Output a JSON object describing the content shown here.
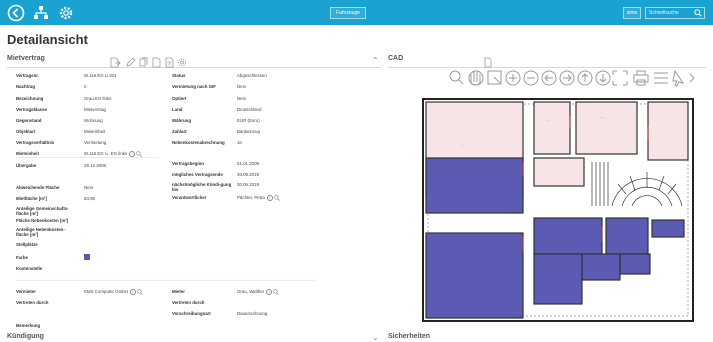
{
  "header": {
    "center_button": "Fahrzeuge",
    "search_button": "sims",
    "search_placeholder": "Schnellsuche"
  },
  "page": {
    "title": "Detailansicht"
  },
  "mietvertrag": {
    "title": "Mietvertrag",
    "left_fields": [
      {
        "label": "Vertragsnr.",
        "value": "W.116.EG Li.001"
      },
      {
        "label": "Nachtrag",
        "value": "0"
      },
      {
        "label": "Bezeichnung",
        "value": "Grau.EG links"
      },
      {
        "label": "Vertragsklasse",
        "value": "Mietvertrag"
      },
      {
        "label": "Gegenstand",
        "value": "Wohnung"
      },
      {
        "label": "Objektart",
        "value": "Mieteinheit"
      },
      {
        "label": "Vertragsverhältnis",
        "value": "Vermietung"
      },
      {
        "label": "Mieteinheit",
        "value": "W.116.EG Li. EG links"
      },
      {
        "label": "Übergabe",
        "value": "29.12.2008"
      }
    ],
    "right_fields": [
      {
        "label": "Status",
        "value": "Abgeschlossen"
      },
      {
        "label": "Vermietung nach GIF",
        "value": "Nein"
      },
      {
        "label": "Optiert",
        "value": "Nein"
      },
      {
        "label": "Land",
        "value": "Deutschland"
      },
      {
        "label": "Währung",
        "value": "EUR (Euro)"
      },
      {
        "label": "Zahlart",
        "value": "Bankeinzug"
      },
      {
        "label": "Nebenkostenabrechnung",
        "value": "Ja"
      }
    ],
    "date_fields": [
      {
        "label": "Vertragsbeginn",
        "value": "01.01.2009"
      },
      {
        "label": "mögliches Vertragsende",
        "value": "30.09.2019"
      },
      {
        "label": "nächstmögliche Kündi-gung bis",
        "value": "30.06.2019"
      },
      {
        "label": "Verantwortlicher",
        "value": "Pächter, Petra"
      }
    ],
    "area_fields": [
      {
        "label": "Abweichende Fläche",
        "value": "Nein"
      },
      {
        "label": "Mietfläche [m²]",
        "value": "83,95"
      },
      {
        "label": "Anteilige Gemeinschafts-fläche [m²]",
        "value": ""
      },
      {
        "label": "Fläche Nebenkosten [m²]",
        "value": ""
      },
      {
        "label": "Anteilige Nebenkosten-fläche [m²]",
        "value": ""
      },
      {
        "label": "Stellplätze",
        "value": ""
      },
      {
        "label": "Farbe",
        "value": ""
      },
      {
        "label": "Kostenstelle",
        "value": ""
      }
    ],
    "party_left": [
      {
        "label": "Vermieter",
        "value": "KMS Computer GmbH"
      },
      {
        "label": "Vertreten durch",
        "value": ""
      }
    ],
    "party_right": [
      {
        "label": "Mieter",
        "value": "Grau, Walther"
      },
      {
        "label": "Vertreten durch",
        "value": ""
      },
      {
        "label": "Vorschreibungsart",
        "value": "Dauerrechnung"
      }
    ],
    "remark_label": "Bemerkung",
    "color_swatch": "#5b5bb3"
  },
  "cad": {
    "title": "CAD"
  },
  "bottom": {
    "left": "Kündigung",
    "right": "Sicherheiten"
  },
  "colors": {
    "topbar": "#1aa3d0",
    "room_pink": "#f6e4e6",
    "room_blue": "#5b5bb3"
  }
}
